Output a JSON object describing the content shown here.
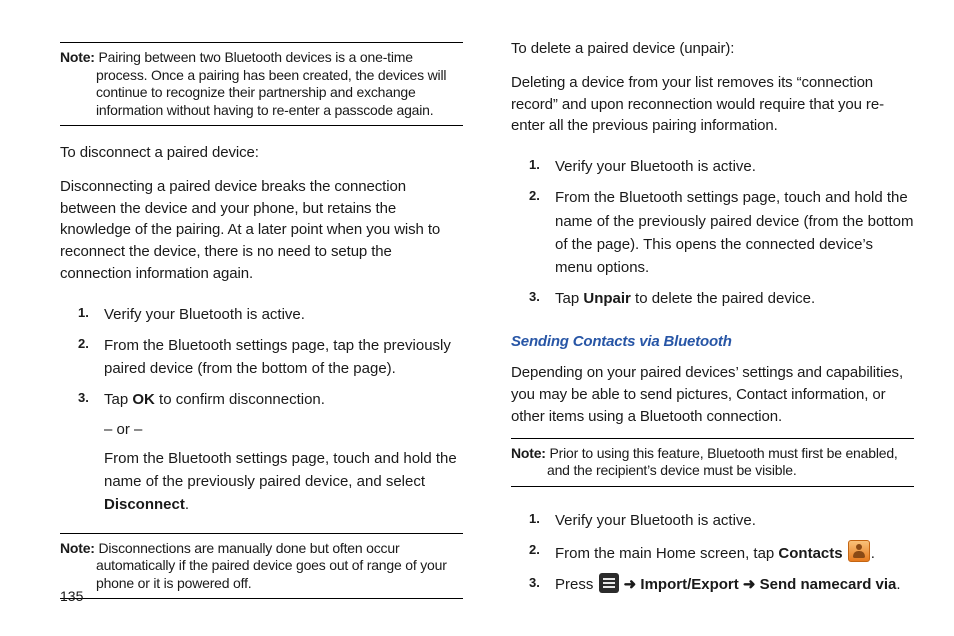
{
  "left": {
    "note1": {
      "label": "Note:",
      "text": "Pairing between two Bluetooth devices is a one-time process. Once a pairing has been created, the devices will continue to recognize their partnership and exchange information without having to re-enter a passcode again."
    },
    "disconnect_intro": "To disconnect a paired device:",
    "disconnect_desc": "Disconnecting a paired device breaks the connection between the device and your phone, but retains the knowledge of the pairing. At a later point when you wish to reconnect the device, there is no need to setup the connection information again.",
    "step1": "Verify your Bluetooth is active.",
    "step2": "From the Bluetooth settings page, tap the previously paired device (from the bottom of the page).",
    "step3_pre": "Tap ",
    "step3_bold": "OK",
    "step3_post": " to confirm disconnection.",
    "step3_or": "– or –",
    "step3_alt_pre": "From the Bluetooth settings page, touch and hold the name of the previously paired device, and select ",
    "step3_alt_bold": "Disconnect",
    "step3_alt_post": ".",
    "note2": {
      "label": "Note:",
      "text": "Disconnections are manually done but often occur automatically if the paired device goes out of range of your phone or it is powered off."
    }
  },
  "right": {
    "delete_intro": "To delete a paired device (unpair):",
    "delete_desc": "Deleting a device from your list removes its “connection record” and upon reconnection would require that you re-enter all the previous pairing information.",
    "d_step1": "Verify your Bluetooth is active.",
    "d_step2": "From the Bluetooth settings page, touch and hold the name of the previously paired device (from the bottom of the page). This opens the connected device’s menu options.",
    "d_step3_pre": "Tap ",
    "d_step3_bold": "Unpair",
    "d_step3_post": " to delete the paired device.",
    "subheading": "Sending Contacts via Bluetooth",
    "send_desc": "Depending on your paired devices’ settings and capabilities, you may be able to send pictures, Contact information, or other items using a Bluetooth connection.",
    "note3": {
      "label": "Note:",
      "text": "Prior to using this feature, Bluetooth must first be enabled, and the recipient’s device must be visible."
    },
    "s_step1": "Verify your Bluetooth is active.",
    "s_step2_pre": "From the main Home screen, tap ",
    "s_step2_bold": "Contacts",
    "s_step2_post": ".",
    "s_step3_pre": "Press ",
    "s_step3_arrow": " ➜ ",
    "s_step3_b1": "Import/Export",
    "s_step3_b2": "Send namecard via",
    "s_step3_end": "."
  },
  "page_number": "135"
}
